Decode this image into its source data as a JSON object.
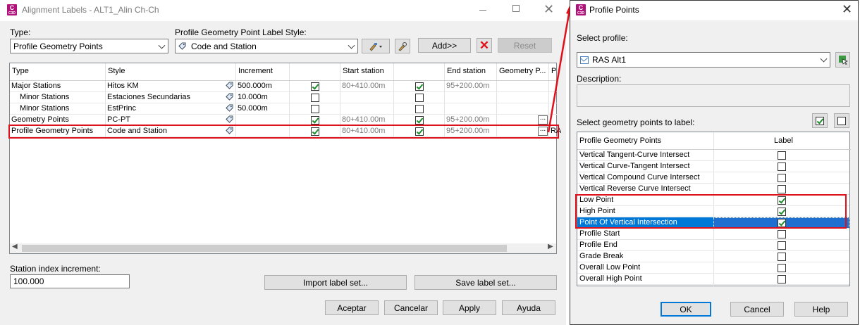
{
  "left": {
    "title": "Alignment Labels - ALT1_Alin Ch-Ch",
    "type_label": "Type:",
    "type_value": "Profile Geometry Points",
    "style_label": "Profile Geometry Point Label Style:",
    "style_value": "Code and Station",
    "add_label": "Add>>",
    "reset_label": "Reset",
    "columns": [
      "Type",
      "Style",
      "Increment",
      "Start station",
      "End station",
      "Geometry P...",
      "P"
    ],
    "rows": [
      {
        "type": "Major Stations",
        "style": "Hitos KM",
        "increment": "500.000m",
        "start": "80+410.00m",
        "end": "95+200.00m",
        "cb1": true,
        "cb2": true,
        "geo": "",
        "p": ""
      },
      {
        "type": "Minor Stations",
        "style": "Estaciones Secundarias",
        "increment": "10.000m",
        "start": "",
        "end": "",
        "cb1": false,
        "cb2": false,
        "geo": "",
        "p": ""
      },
      {
        "type": "Minor Stations",
        "style": "EstPrinc",
        "increment": "50.000m",
        "start": "",
        "end": "",
        "cb1": false,
        "cb2": false,
        "geo": "",
        "p": ""
      },
      {
        "type": "Geometry Points",
        "style": "PC-PT",
        "increment": "",
        "start": "80+410.00m",
        "end": "95+200.00m",
        "cb1": true,
        "cb2": true,
        "geo": "...",
        "p": ""
      },
      {
        "type": "Profile Geometry Points",
        "style": "Code and Station",
        "increment": "",
        "start": "80+410.00m",
        "end": "95+200.00m",
        "cb1": true,
        "cb2": true,
        "geo": "...",
        "p": "RA"
      }
    ],
    "station_index_label": "Station index increment:",
    "station_index_value": "100.000",
    "import_label": "Import label set...",
    "save_label": "Save label set...",
    "accept_label": "Aceptar",
    "cancel_label": "Cancelar",
    "apply_label": "Apply",
    "help_label": "Ayuda"
  },
  "right": {
    "title": "Profile Points",
    "select_profile_label": "Select profile:",
    "profile_value": "RAS Alt1",
    "description_label": "Description:",
    "select_points_label": "Select geometry points to label:",
    "col_points": "Profile Geometry Points",
    "col_label": "Label",
    "points": [
      {
        "name": "Vertical Tangent-Curve Intersect",
        "checked": false
      },
      {
        "name": "Vertical Curve-Tangent Intersect",
        "checked": false
      },
      {
        "name": "Vertical Compound Curve Intersect",
        "checked": false
      },
      {
        "name": "Vertical Reverse Curve Intersect",
        "checked": false
      },
      {
        "name": "Low Point",
        "checked": true
      },
      {
        "name": "High Point",
        "checked": true
      },
      {
        "name": "Point Of Vertical Intersection",
        "checked": true,
        "selected": true
      },
      {
        "name": "Profile Start",
        "checked": false
      },
      {
        "name": "Profile End",
        "checked": false
      },
      {
        "name": "Grade Break",
        "checked": false
      },
      {
        "name": "Overall Low Point",
        "checked": false
      },
      {
        "name": "Overall High Point",
        "checked": false
      }
    ],
    "ok_label": "OK",
    "cancel_label": "Cancel",
    "help_label": "Help"
  },
  "colors": {
    "accent": "#0078d7",
    "highlight_box": "#e0101a",
    "app_icon": "#b0117a"
  }
}
